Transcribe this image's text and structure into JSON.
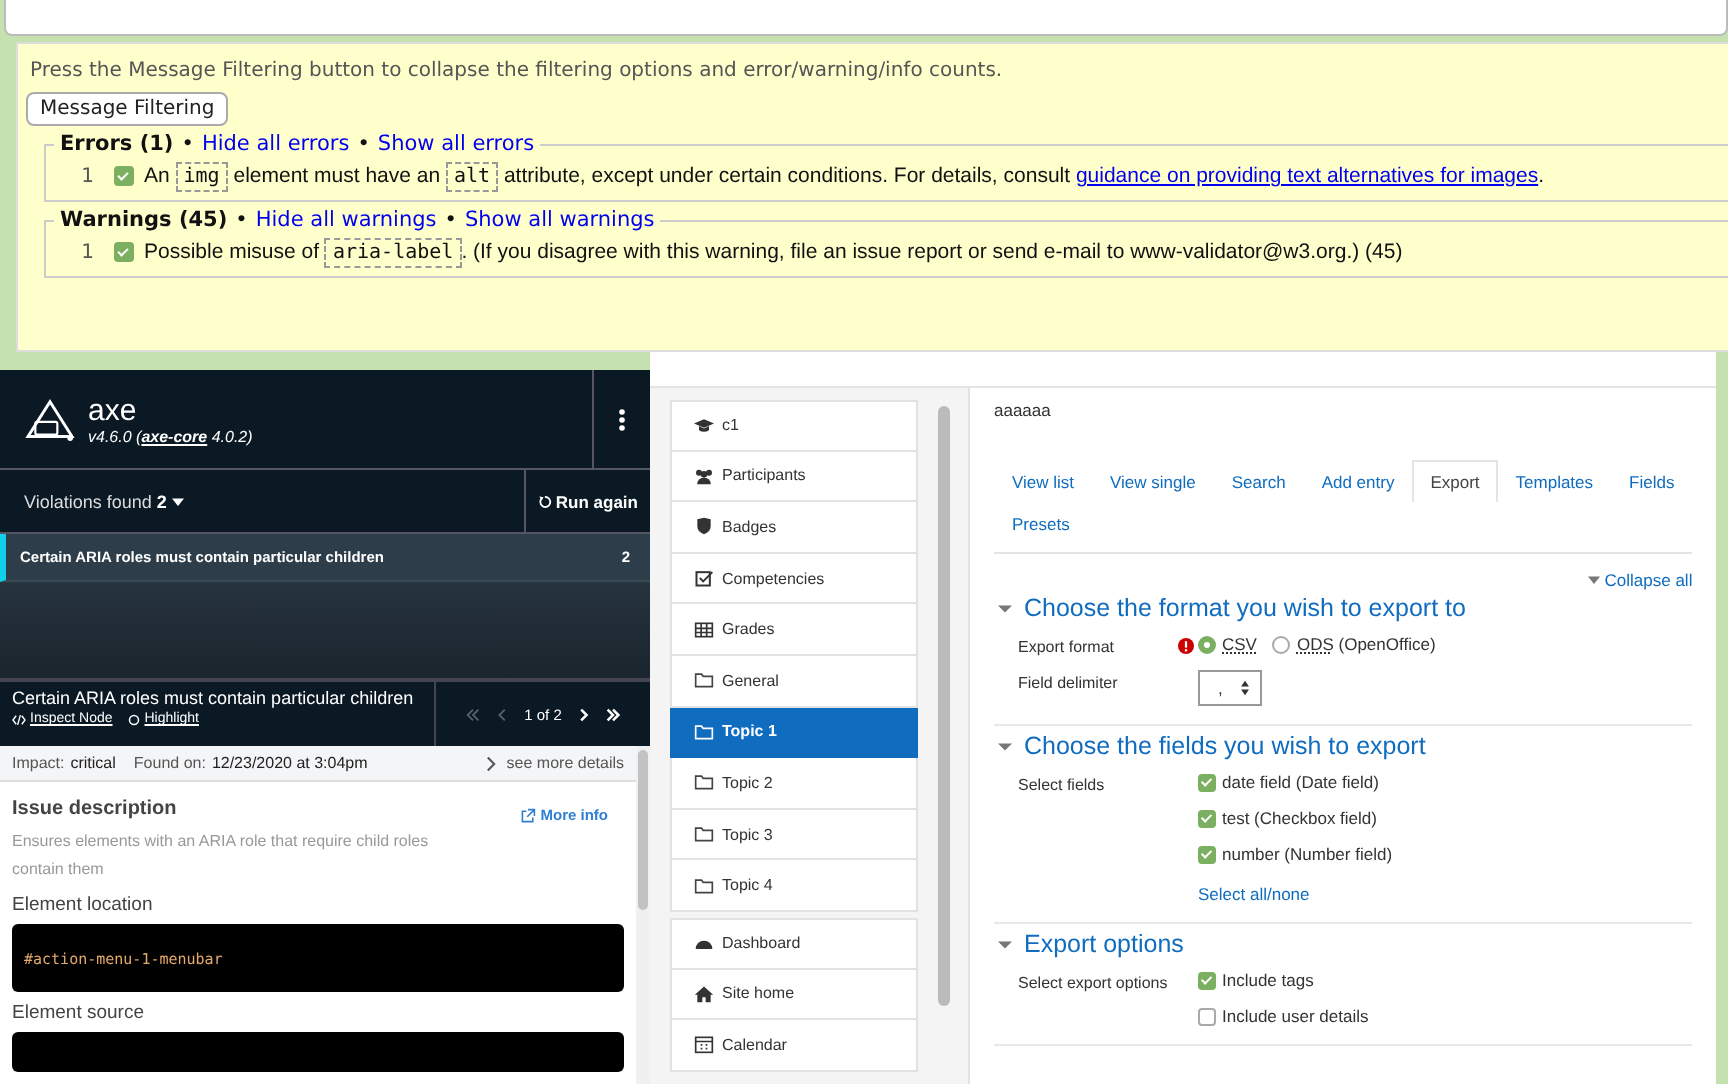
{
  "validator": {
    "intro": "Press the Message Filtering button to collapse the filtering options and error/warning/info counts.",
    "filter_button": "Message Filtering",
    "separator": "•",
    "groups": [
      {
        "title": "Errors (1)",
        "hide_link": "Hide all errors",
        "show_link": "Show all errors",
        "messages": [
          {
            "number": "1",
            "checked": true,
            "parts": [
              {
                "kind": "text",
                "text": "An "
              },
              {
                "kind": "code",
                "text": "img"
              },
              {
                "kind": "text",
                "text": " element must have an "
              },
              {
                "kind": "code",
                "text": "alt"
              },
              {
                "kind": "text",
                "text": " attribute, except under certain conditions. For details, consult "
              },
              {
                "kind": "link",
                "text": "guidance on providing text alternatives for images"
              },
              {
                "kind": "text",
                "text": "."
              }
            ]
          }
        ]
      },
      {
        "title": "Warnings (45)",
        "hide_link": "Hide all warnings",
        "show_link": "Show all warnings",
        "messages": [
          {
            "number": "1",
            "checked": true,
            "parts": [
              {
                "kind": "text",
                "text": "Possible misuse of "
              },
              {
                "kind": "code",
                "text": "aria-label"
              },
              {
                "kind": "text",
                "text": ". (If you disagree with this warning, file an issue report or send e-mail to www-validator@w3.org.) (45)"
              }
            ]
          }
        ]
      }
    ]
  },
  "axe": {
    "name": "axe",
    "version_prefix": "v4.6.0 (",
    "core_link": "axe-core",
    "version_suffix": " 4.0.2)",
    "violations_label": "Violations found",
    "violations_count": "2",
    "run_again": "Run again",
    "issues": [
      {
        "title": "Certain ARIA roles must contain particular children",
        "count": "2",
        "selected": true
      }
    ],
    "detail": {
      "title": "Certain ARIA roles must contain particular children",
      "inspect": "Inspect Node",
      "highlight": "Highlight",
      "pager": "1 of 2",
      "impact_label": "Impact:",
      "impact": "critical",
      "found_label": "Found on:",
      "found": "12/23/2020 at 3:04pm",
      "see_more": "see more details",
      "issue_heading": "Issue description",
      "more_info": "More info",
      "description": "Ensures elements with an ARIA role that require child roles contain them",
      "location_heading": "Element location",
      "location": "#action-menu-1-menubar",
      "source_heading": "Element source"
    }
  },
  "nav": {
    "groups": [
      [
        {
          "kind": "course",
          "label": "c1",
          "selected": false
        },
        {
          "kind": "participants",
          "label": "Participants",
          "selected": false
        },
        {
          "kind": "badges",
          "label": "Badges",
          "selected": false
        },
        {
          "kind": "competencies",
          "label": "Competencies",
          "selected": false
        },
        {
          "kind": "grades",
          "label": "Grades",
          "selected": false
        },
        {
          "kind": "section",
          "label": "General",
          "selected": false
        },
        {
          "kind": "section",
          "label": "Topic 1",
          "selected": true
        },
        {
          "kind": "section",
          "label": "Topic 2",
          "selected": false
        },
        {
          "kind": "section",
          "label": "Topic 3",
          "selected": false
        },
        {
          "kind": "section",
          "label": "Topic 4",
          "selected": false
        }
      ],
      [
        {
          "kind": "dashboard",
          "label": "Dashboard",
          "selected": false
        },
        {
          "kind": "home",
          "label": "Site home",
          "selected": false
        },
        {
          "kind": "calendar",
          "label": "Calendar",
          "selected": false
        }
      ]
    ]
  },
  "content": {
    "title": "aaaaaa",
    "tabs": [
      {
        "label": "View list",
        "selected": false
      },
      {
        "label": "View single",
        "selected": false
      },
      {
        "label": "Search",
        "selected": false
      },
      {
        "label": "Add entry",
        "selected": false
      },
      {
        "label": "Export",
        "selected": true
      },
      {
        "label": "Templates",
        "selected": false
      },
      {
        "label": "Fields",
        "selected": false
      },
      {
        "label": "Presets",
        "selected": false
      }
    ],
    "collapse_all": "Collapse all",
    "sections": [
      {
        "title": "Choose the format you wish to export to",
        "expanded": true,
        "rows": [
          {
            "kind": "radio",
            "label": "Export format",
            "required": true,
            "options": [
              {
                "label": "CSV",
                "selected": true
              },
              {
                "label": "ODS",
                "note": " (OpenOffice)",
                "selected": false
              }
            ]
          },
          {
            "kind": "select",
            "label": "Field delimiter",
            "value": ","
          }
        ]
      },
      {
        "title": "Choose the fields you wish to export",
        "expanded": true,
        "rows": [
          {
            "kind": "checkboxes",
            "label": "Select fields",
            "options": [
              {
                "label": "date field (Date field)",
                "checked": true
              },
              {
                "label": "test (Checkbox field)",
                "checked": true
              },
              {
                "label": "number (Number field)",
                "checked": true
              }
            ],
            "link": "Select all/none"
          }
        ]
      },
      {
        "title": "Export options",
        "expanded": true,
        "rows": [
          {
            "kind": "checkboxes",
            "label": "Select export options",
            "options": [
              {
                "label": "Include tags",
                "checked": true
              },
              {
                "label": "Include user details",
                "checked": false
              }
            ]
          }
        ]
      }
    ]
  }
}
